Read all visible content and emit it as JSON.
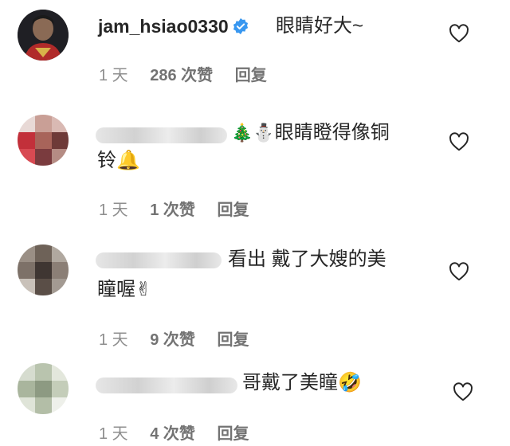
{
  "comments": [
    {
      "author": "jam_hsiao0330",
      "verified": true,
      "text": "眼睛好大~",
      "time": "1 天",
      "likes": "286 次赞",
      "reply": "回复"
    },
    {
      "emojis": "🎄⛄",
      "text_line1": "眼睛瞪得像铜",
      "text_line2": "铃🔔",
      "time": "1 天",
      "likes": "1 次赞",
      "reply": "回复"
    },
    {
      "text_line1": "看出 戴了大嫂的美",
      "text_line2": "瞳喔✌",
      "time": "1 天",
      "likes": "9 次赞",
      "reply": "回复"
    },
    {
      "text_line1": "哥戴了美瞳🤣",
      "time": "1 天",
      "likes": "4 次赞",
      "reply": "回复"
    }
  ],
  "colors": {
    "text": "#262626",
    "meta": "#8e8e8e",
    "verified": "#3897f0"
  }
}
